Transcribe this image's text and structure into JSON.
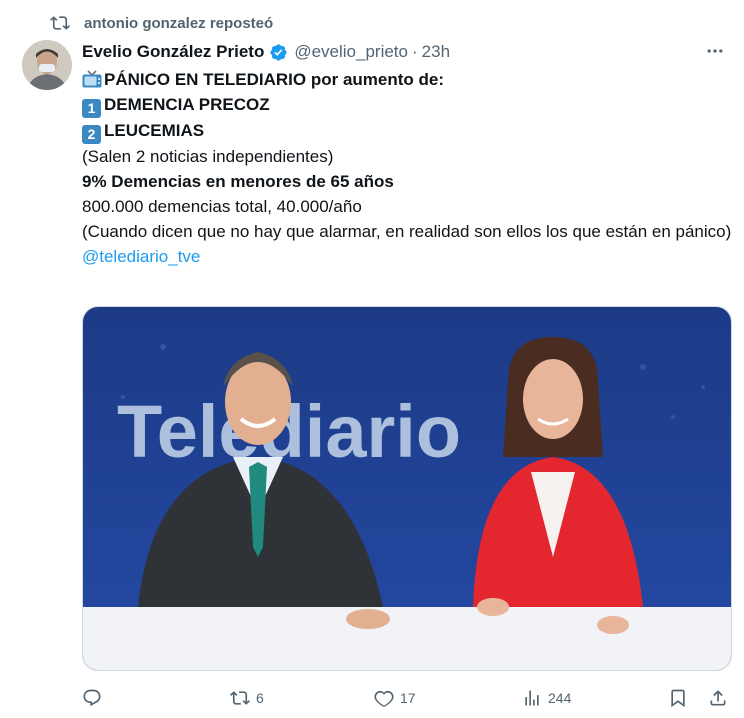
{
  "repost": {
    "text": "antonio gonzalez reposteó",
    "icon": "repost-icon"
  },
  "tweet": {
    "author_name": "Evelio González Prieto",
    "verified_icon": "verified-badge-icon",
    "handle": "@evelio_prieto",
    "separator": "·",
    "time": "23h",
    "more_icon": "more-options-icon",
    "lines": {
      "headline": "PÁNICO EN TELEDIARIO por aumento de:",
      "item1_key": "1",
      "item1": "DEMENCIA PRECOZ",
      "item2_key": "2",
      "item2": "LEUCEMIAS",
      "note": "(Salen 2 noticias independientes)",
      "stat": "9% Demencias en menores de 65 años",
      "totals": "800.000 demencias total, 40.000/año",
      "comment": "(Cuando dicen que no hay que alarmar, en realidad son ellos los que están en pánico)",
      "mention": "@telediario_tve"
    },
    "media": {
      "set_text": "Telediario"
    }
  },
  "actions": {
    "reply_icon": "reply-icon",
    "retweets": "6",
    "likes": "17",
    "views": "244",
    "bookmark_icon": "bookmark-icon",
    "share_icon": "share-icon"
  },
  "colors": {
    "link": "#1d9bf0",
    "verified": "#1d9bf0",
    "secondary_text": "#536471",
    "keycap": "#3b88c3"
  }
}
